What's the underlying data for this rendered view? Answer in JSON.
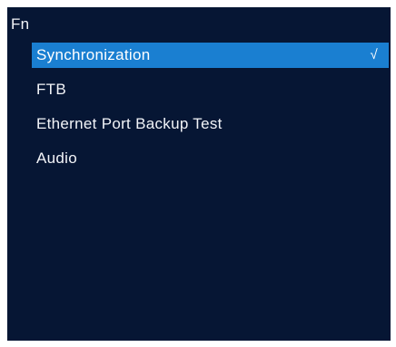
{
  "menu": {
    "title": "Fn",
    "items": [
      {
        "label": "Synchronization",
        "selected": true,
        "check": "√"
      },
      {
        "label": "FTB",
        "selected": false
      },
      {
        "label": "Ethernet Port Backup Test",
        "selected": false
      },
      {
        "label": "Audio",
        "selected": false
      }
    ]
  },
  "colors": {
    "background": "#061634",
    "highlight": "#1a7fd1",
    "text": "#f2f4f8"
  },
  "icons": {
    "selected_indicator": "check-icon"
  }
}
